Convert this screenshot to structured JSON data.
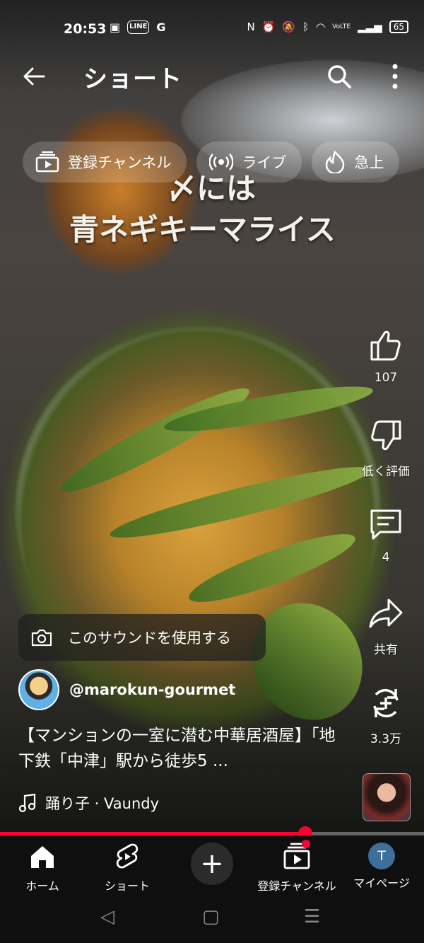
{
  "status_bar": {
    "time": "20:53",
    "app_icons": [
      "photos-icon",
      "line-icon",
      "google-icon"
    ],
    "line_text": "LINE",
    "g_text": "G",
    "battery": "65",
    "volte": "VoLTE"
  },
  "header": {
    "title": "ショート"
  },
  "chips": [
    {
      "label": "登録チャンネル",
      "icon": "subscriptions-icon"
    },
    {
      "label": "ライブ",
      "icon": "live-icon"
    },
    {
      "label": "急上",
      "icon": "trending-icon"
    }
  ],
  "video": {
    "caption_line1": "〆には",
    "caption_line2": "青ネギキーマライス"
  },
  "actions": {
    "like_count": "107",
    "dislike_label": "低く評価",
    "comments_count": "4",
    "share_label": "共有",
    "remix_count": "3.3万"
  },
  "sound_button": "このサウンドを使用する",
  "channel": {
    "handle": "@marokun-gourmet"
  },
  "description": "【マンションの一室に潜む中華居酒屋】「地下鉄「中津」駅から徒歩5 ...",
  "music": "踊り子 · Vaundy",
  "progress": 0.72,
  "nav": {
    "home": "ホーム",
    "shorts": "ショート",
    "subscriptions": "登録チャンネル",
    "you": "マイページ",
    "you_initial": "T"
  },
  "colors": {
    "accent": "#ff0033",
    "nav_bg": "#0f0f0f"
  }
}
